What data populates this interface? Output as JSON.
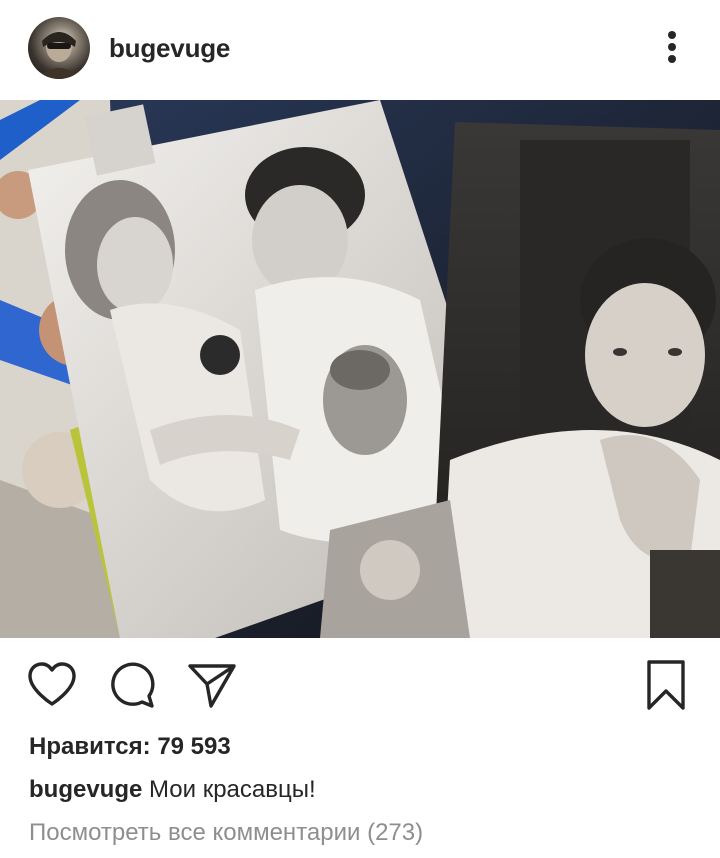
{
  "post": {
    "username": "bugevuge",
    "likes_label": "Нравится:",
    "likes_count": "79 593",
    "caption_username": "bugevuge",
    "caption_text": "Мои красавцы!",
    "view_comments": "Посмотреть все комментарии (273)"
  },
  "icons": {
    "avatar": "avatar",
    "more": "more-vertical-icon",
    "like": "heart-icon",
    "comment": "comment-icon",
    "share": "send-icon",
    "save": "bookmark-icon"
  },
  "colors": {
    "text": "#262626",
    "muted": "#8e8e8e",
    "background": "#ffffff"
  }
}
